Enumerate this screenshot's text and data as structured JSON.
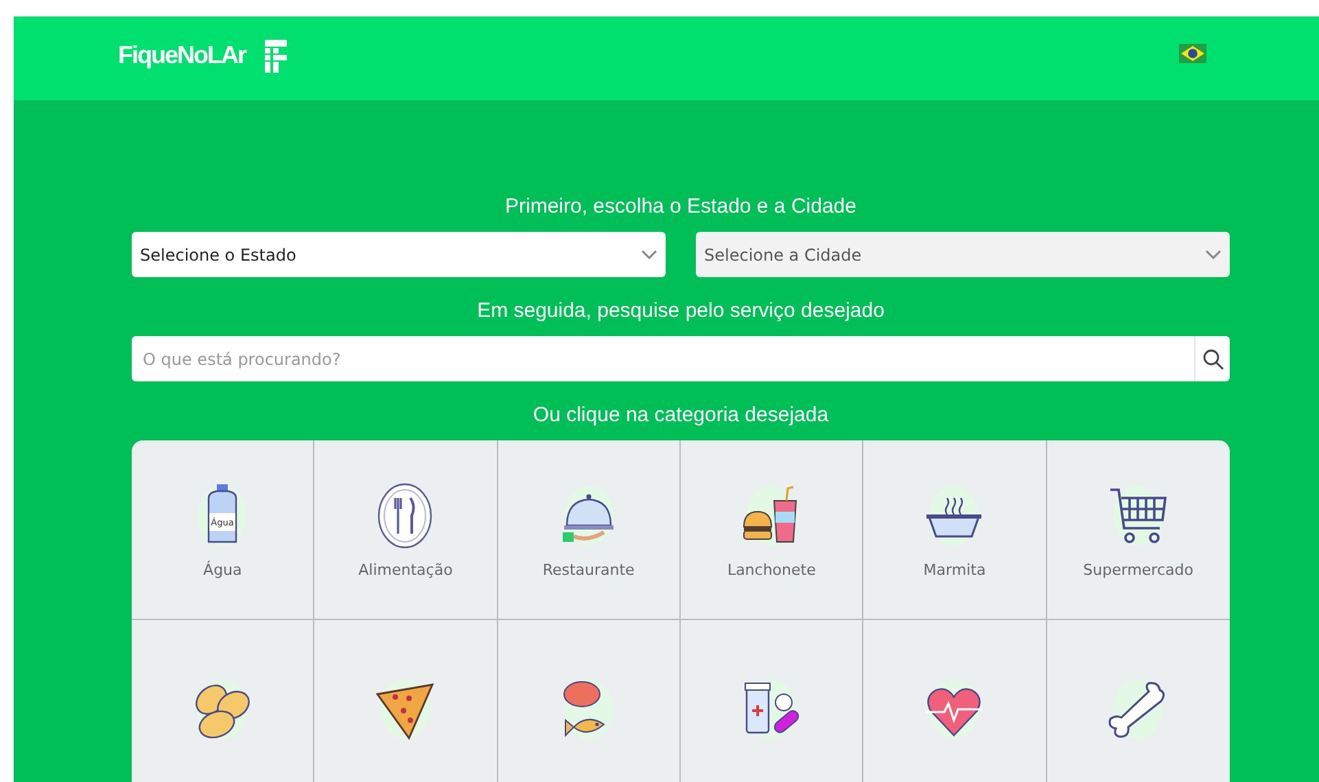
{
  "header": {
    "logo": "FiqueNoLAr"
  },
  "step_state": "Primeiro, escolha o Estado e a Cidade",
  "state_select": {
    "value": "Selecione o Estado",
    "disabled": false
  },
  "city_select": {
    "value": "Selecione a Cidade",
    "disabled": true
  },
  "step_search": "Em seguida, pesquise pelo serviço desejado",
  "search": {
    "placeholder": "O que está procurando?"
  },
  "step_category": "Ou clique na categoria desejada",
  "bottle_label": "Água",
  "categories": [
    {
      "kind": "water",
      "label": "Água"
    },
    {
      "kind": "plate",
      "label": "Alimentação"
    },
    {
      "kind": "cloche",
      "label": "Restaurante"
    },
    {
      "kind": "burger",
      "label": "Lanchonete"
    },
    {
      "kind": "bowl",
      "label": "Marmita"
    },
    {
      "kind": "cart",
      "label": "Supermercado"
    },
    {
      "kind": "bread"
    },
    {
      "kind": "pizza"
    },
    {
      "kind": "meat"
    },
    {
      "kind": "pills"
    },
    {
      "kind": "heart"
    },
    {
      "kind": "bone"
    }
  ]
}
